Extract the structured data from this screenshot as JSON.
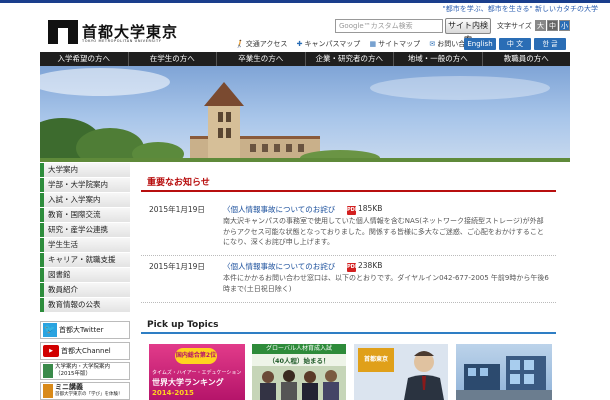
{
  "header": {
    "slogan": "\"都市を学ぶ、都市を生きる\" 新しいカタチの大学",
    "logo_title": "首都大学東京",
    "logo_sub": "TOKYO METROPOLITAN UNIVERSITY",
    "search_placeholder": "Google™カスタム検索",
    "search_button": "サイト内検索",
    "font_size_label": "文字サイズ",
    "font_sizes": [
      "大",
      "中",
      "小"
    ],
    "util_links": [
      "交通アクセス",
      "キャンパスマップ",
      "サイトマップ",
      "お問い合せ一覧"
    ],
    "languages": [
      "English",
      "中 文",
      "한 글"
    ]
  },
  "nav": {
    "items": [
      "入学希望の方へ",
      "在学生の方へ",
      "卒業生の方へ",
      "企業・研究者の方へ",
      "地域・一般の方へ",
      "教職員の方へ"
    ]
  },
  "sidebar": {
    "items": [
      "大学案内",
      "学部・大学院案内",
      "入試・入学案内",
      "教育・国際交流",
      "研究・産学公連携",
      "学生生活",
      "キャリア・就職支援",
      "図書館",
      "教員紹介",
      "教育情報の公表"
    ],
    "banners": {
      "twitter": "首都大Twitter",
      "youtube": "首都大Channel",
      "guide": "大学案内・大学院案内（2015年版）",
      "mini_title": "ミニ講義",
      "mini_sub": "首都大学東京の「学び」を体験！"
    }
  },
  "notices": {
    "heading": "重要なお知らせ",
    "items": [
      {
        "date": "2015年1月19日",
        "title": "個人情報事故についてのお詫び",
        "size": "185KB",
        "body": "南大沢キャンパスの事務室で使用していた個人情報を含むNAS(ネットワーク接続型ストレージ)が外部からアクセス可能な状態となっておりました。関係する皆様に多大なご迷惑、ご心配をおかけすることになり、深くお詫び申し上げます。"
      },
      {
        "date": "2015年1月19日",
        "title": "個人情報事故についてのお詫び",
        "size": "238KB",
        "body": "本件にかかるお問い合わせ窓口は、以下のとおりです。ダイヤルイン042-677-2005 午前9時から午後6時まで(土日祝日除く)"
      }
    ]
  },
  "pickup": {
    "heading": "Pick up Topics",
    "card1_badge": "国内総合第2位",
    "card1_line1": "タイムズ・ハイアー・エデュケーション",
    "card1_line2": "世界大学ランキング",
    "card1_year": "2014-2015",
    "card2_line1": "グローバル人材育成入試",
    "card2_line2": "（40人程）始まる！",
    "card3_text": "首都東京"
  },
  "colors": {
    "brand_blue": "#1a3e8c",
    "accent_red": "#b80f0f",
    "sidebar_green": "#2d8d3c",
    "nav_black": "#1f1f1f"
  }
}
